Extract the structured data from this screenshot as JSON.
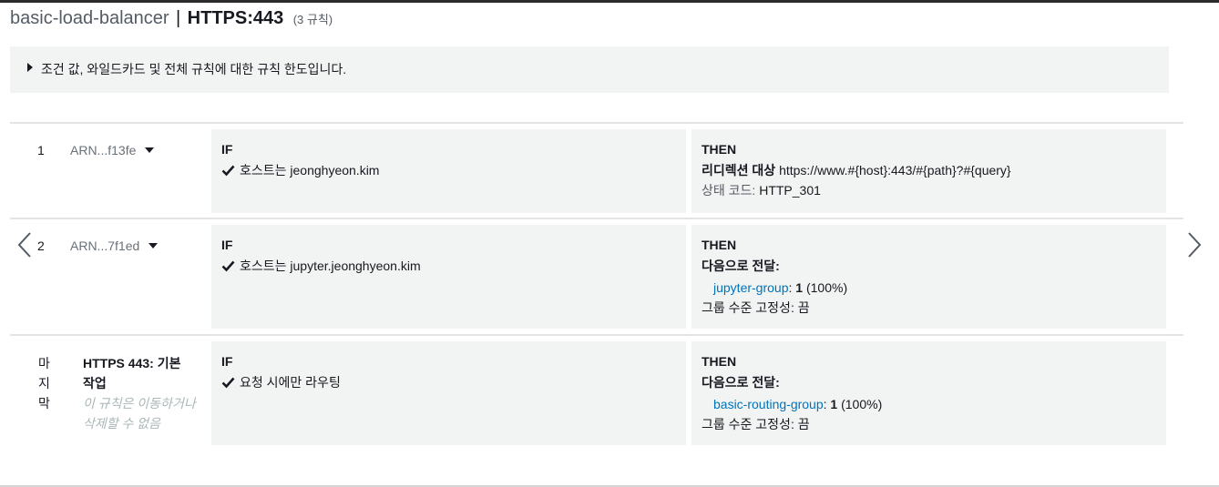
{
  "header": {
    "lb_name": "basic-load-balancer",
    "separator": "|",
    "listener": "HTTPS:443",
    "rule_count": "(3 규칙)"
  },
  "info": {
    "text": "조건 값, 와일드카드 및 전체 규칙에 대한 규칙 한도입니다."
  },
  "rules": [
    {
      "number": "1",
      "arn": "ARN...f13fe",
      "if_label": "IF",
      "condition": "호스트는 jeonghyeon.kim",
      "then_label": "THEN",
      "action_label": "리디렉션 대상",
      "redirect_url": "https://www.#{host}:443/#{path}?#{query}",
      "status_label": "상태 코드:",
      "status_value": "HTTP_301"
    },
    {
      "number": "2",
      "arn": "ARN...7f1ed",
      "if_label": "IF",
      "condition": "호스트는 jupyter.jeonghyeon.kim",
      "then_label": "THEN",
      "action_label": "다음으로 전달:",
      "target_group": "jupyter-group",
      "colon": ":",
      "weight": "1",
      "percent": "(100%)",
      "stickiness": "그룹 수준 고정성: 끔"
    },
    {
      "number": "마지막",
      "title": "HTTPS 443: 기본 작업",
      "note": "이 규칙은 이동하거나 삭제할 수 없음",
      "if_label": "IF",
      "condition": "요청 시에만 라우팅",
      "then_label": "THEN",
      "action_label": "다음으로 전달:",
      "target_group": "basic-routing-group",
      "colon": ":",
      "weight": "1",
      "percent": "(100%)",
      "stickiness": "그룹 수준 고정성: 끔"
    }
  ],
  "colors": {
    "link": "#0073bb",
    "cell_bg": "#f2f3f3",
    "muted_text": "#687078",
    "placeholder_text": "#aab7b8"
  },
  "icons": {
    "prev": "chevron-left-icon",
    "next": "chevron-right-icon",
    "expand": "triangle-right-icon",
    "check": "check-icon",
    "caret": "caret-down-icon"
  }
}
